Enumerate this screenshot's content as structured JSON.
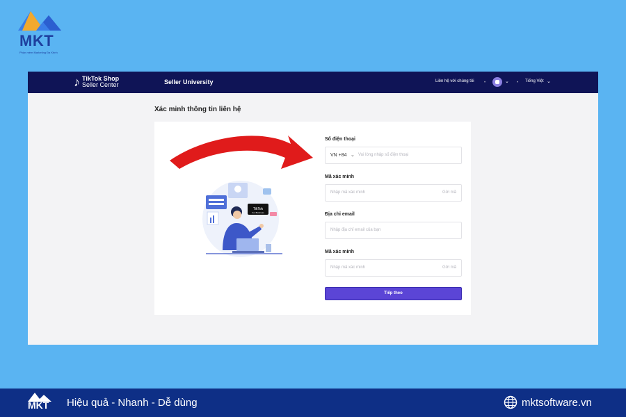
{
  "brand": {
    "logo_text": "MKT",
    "tagline": "Phần mềm Marketing Đa Kênh"
  },
  "app": {
    "logo_line1": "TikTok Shop",
    "logo_line2": "Seller Center",
    "nav_seller_university": "Seller University",
    "contact_link": "Liên hệ với chúng tôi",
    "language": "Tiếng Việt"
  },
  "page": {
    "title": "Xác minh thông tin liên hệ"
  },
  "form": {
    "phone_label": "Số điện thoại",
    "country_code": "VN +84",
    "phone_placeholder": "Vui lòng nhập số điện thoại",
    "code_label_1": "Mã xác minh",
    "code_placeholder_1": "Nhập mã xác minh",
    "get_code_1": "Gửi mã",
    "email_label": "Địa chỉ email",
    "email_placeholder": "Nhập địa chỉ email của bạn",
    "code_label_2": "Mã xác minh",
    "code_placeholder_2": "Nhập mã xác minh",
    "get_code_2": "Gửi mã",
    "next_button": "Tiếp theo"
  },
  "illustration": {
    "badge_line1": "TikTok",
    "badge_line2": "For Business"
  },
  "footer": {
    "slogan": "Hiệu quả - Nhanh - Dễ dùng",
    "website": "mktsoftware.vn"
  },
  "colors": {
    "background": "#5ab4f2",
    "topbar": "#0f1456",
    "primary_button": "#5b45d6",
    "arrow": "#e01b1b",
    "footer": "#0e2f86"
  }
}
